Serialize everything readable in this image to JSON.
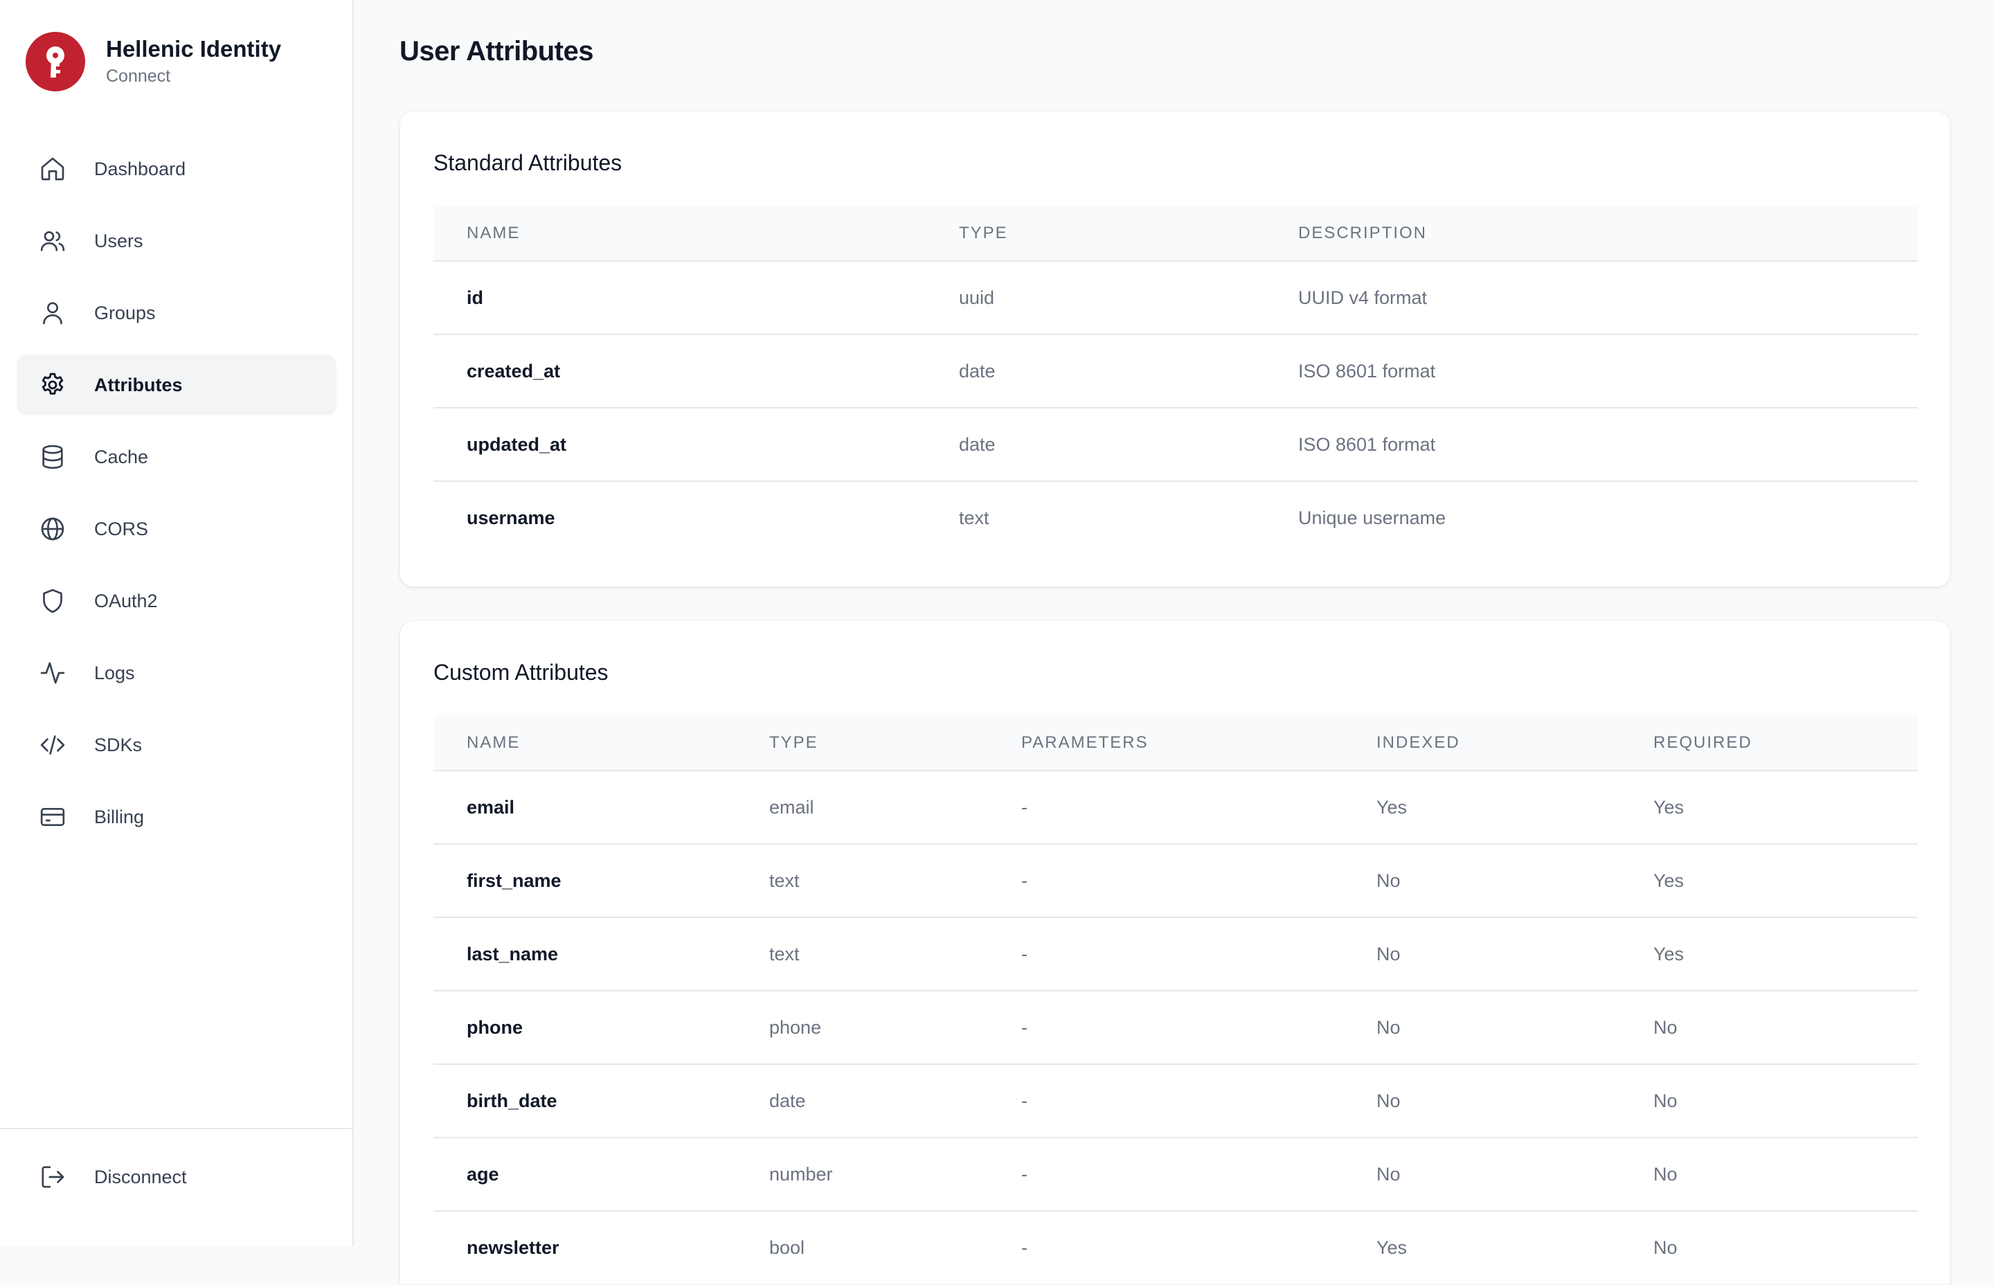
{
  "brand": {
    "title": "Hellenic Identity",
    "subtitle": "Connect",
    "logo_icon": "keyhole-logo-icon",
    "color": "#c1222f"
  },
  "sidebar": {
    "items": [
      {
        "label": "Dashboard",
        "icon": "home-icon",
        "active": false
      },
      {
        "label": "Users",
        "icon": "users-icon",
        "active": false
      },
      {
        "label": "Groups",
        "icon": "user-icon",
        "active": false
      },
      {
        "label": "Attributes",
        "icon": "gear-icon",
        "active": true
      },
      {
        "label": "Cache",
        "icon": "database-icon",
        "active": false
      },
      {
        "label": "CORS",
        "icon": "globe-icon",
        "active": false
      },
      {
        "label": "OAuth2",
        "icon": "shield-icon",
        "active": false
      },
      {
        "label": "Logs",
        "icon": "activity-icon",
        "active": false
      },
      {
        "label": "SDKs",
        "icon": "code-icon",
        "active": false
      },
      {
        "label": "Billing",
        "icon": "credit-card-icon",
        "active": false
      }
    ],
    "footer": {
      "label": "Disconnect",
      "icon": "logout-icon"
    }
  },
  "main": {
    "title": "User Attributes",
    "standard": {
      "title": "Standard Attributes",
      "columns": [
        "NAME",
        "TYPE",
        "DESCRIPTION"
      ],
      "rows": [
        [
          "id",
          "uuid",
          "UUID v4 format"
        ],
        [
          "created_at",
          "date",
          "ISO 8601 format"
        ],
        [
          "updated_at",
          "date",
          "ISO 8601 format"
        ],
        [
          "username",
          "text",
          "Unique username"
        ]
      ]
    },
    "custom": {
      "title": "Custom Attributes",
      "columns": [
        "NAME",
        "TYPE",
        "PARAMETERS",
        "INDEXED",
        "REQUIRED"
      ],
      "rows": [
        [
          "email",
          "email",
          "-",
          "Yes",
          "Yes"
        ],
        [
          "first_name",
          "text",
          "-",
          "No",
          "Yes"
        ],
        [
          "last_name",
          "text",
          "-",
          "No",
          "Yes"
        ],
        [
          "phone",
          "phone",
          "-",
          "No",
          "No"
        ],
        [
          "birth_date",
          "date",
          "-",
          "No",
          "No"
        ],
        [
          "age",
          "number",
          "-",
          "No",
          "No"
        ],
        [
          "newsletter",
          "bool",
          "-",
          "Yes",
          "No"
        ]
      ]
    }
  }
}
